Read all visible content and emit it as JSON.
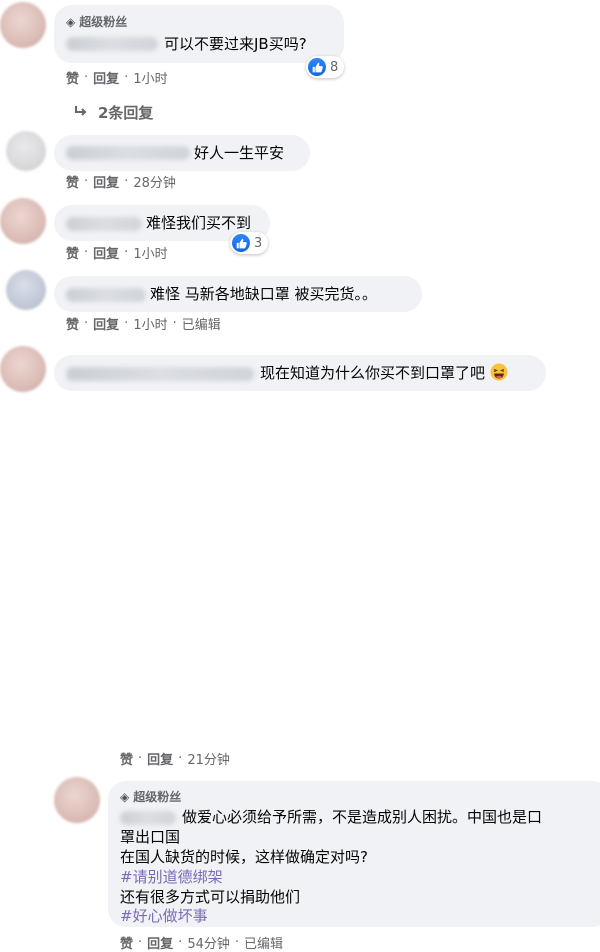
{
  "badge_label": "超级粉丝",
  "actions": {
    "like": "赞",
    "reply": "回复",
    "edited": "已编辑"
  },
  "comments": [
    {
      "text": "可以不要过来JB买吗?",
      "time": "1小时",
      "reactions": "8",
      "replies_label": "2条回复"
    },
    {
      "text": "好人一生平安",
      "time": "28分钟"
    },
    {
      "text": "难怪我们买不到",
      "time": "1小时",
      "reactions": "3"
    },
    {
      "text": "难怪 马新各地缺口罩 被买完货。。",
      "time": "1小时"
    },
    {
      "text": "现在知道为什么你买不到口罩了吧",
      "time": "21分钟"
    },
    {
      "lines": [
        "做爱心必须给予所需，不是造成别人困扰。中国也是口",
        "罩出口国",
        "在国人缺货的时候，这样做确定对吗?",
        "#请别道德绑架",
        "还有很多方式可以捐助他们",
        "#好心做坏事"
      ],
      "time": "54分钟"
    }
  ],
  "colors": {
    "bubble": "#f0f2f5",
    "meta": "#65676b",
    "like_blue": "#1877f2",
    "hashtag": "#7a6bb8"
  }
}
